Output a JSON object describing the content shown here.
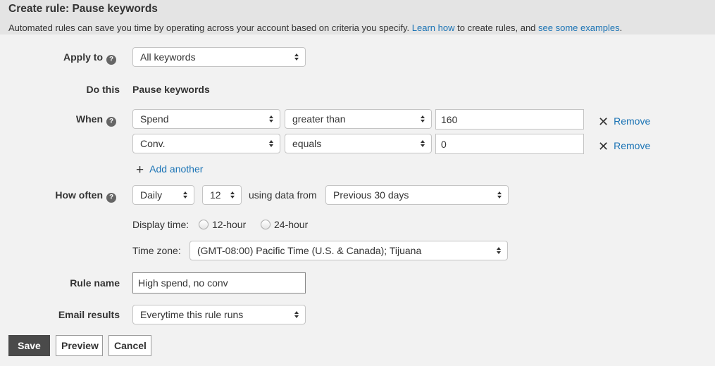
{
  "header": {
    "title": "Create rule: Pause keywords",
    "description_part1": "Automated rules can save you time by operating across your account based on criteria you specify. ",
    "learn_how_link": "Learn how",
    "description_part2": " to create rules, and ",
    "examples_link": "see some examples",
    "description_part3": "."
  },
  "apply_to": {
    "label": "Apply to",
    "help_icon": "question-circle-icon",
    "value": "All keywords"
  },
  "do_this": {
    "label": "Do this",
    "value": "Pause keywords"
  },
  "when": {
    "label": "When",
    "help_icon": "question-circle-icon",
    "conditions": [
      {
        "metric": "Spend",
        "operator": "greater than",
        "value": "160",
        "remove_label": "Remove",
        "remove_icon": "x-icon"
      },
      {
        "metric": "Conv.",
        "operator": "equals",
        "value": "0",
        "remove_label": "Remove",
        "remove_icon": "x-icon"
      }
    ],
    "add_another_label": "Add another",
    "add_icon": "plus-icon"
  },
  "how_often": {
    "label": "How often",
    "help_icon": "question-circle-icon",
    "frequency": "Daily",
    "hour": "12",
    "using_data_from_label": "using data from",
    "date_range": "Previous 30 days",
    "display_time_label": "Display time:",
    "display_time_options": [
      "12-hour",
      "24-hour"
    ],
    "time_zone_label": "Time zone:",
    "time_zone": "(GMT-08:00) Pacific Time (U.S. & Canada); Tijuana"
  },
  "rule_name": {
    "label": "Rule name",
    "value": "High spend, no conv"
  },
  "email_results": {
    "label": "Email results",
    "value": "Everytime this rule runs"
  },
  "buttons": {
    "save": "Save",
    "preview": "Preview",
    "cancel": "Cancel"
  }
}
